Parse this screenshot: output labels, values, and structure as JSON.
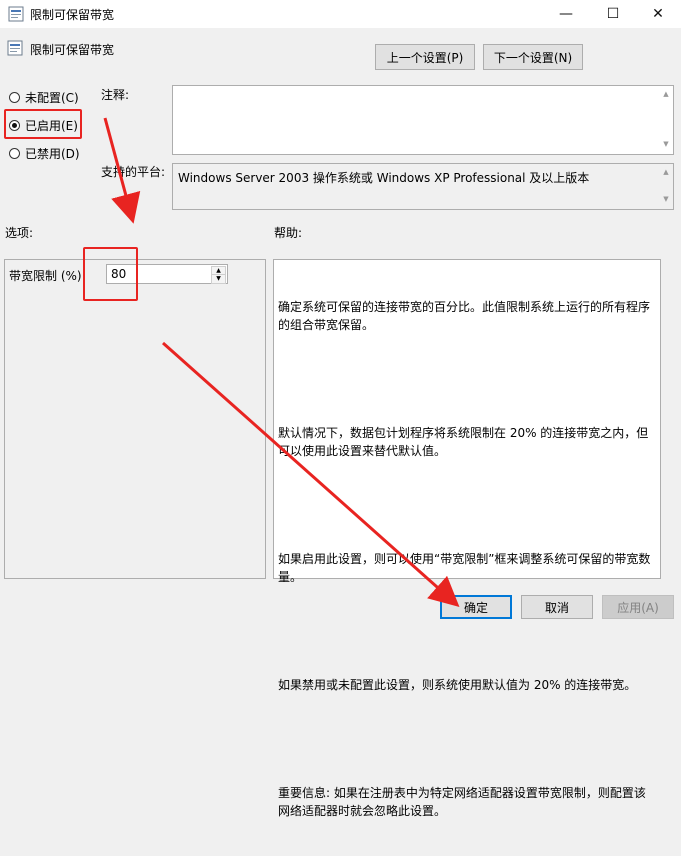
{
  "window": {
    "title": "限制可保留带宽",
    "minimize_glyph": "—",
    "maximize_glyph": "☐",
    "close_glyph": "✕"
  },
  "header": {
    "policy_name": "限制可保留带宽",
    "prev_button": "上一个设置(P)",
    "next_button": "下一个设置(N)"
  },
  "state": {
    "not_configured": "未配置(C)",
    "enabled": "已启用(E)",
    "disabled": "已禁用(D)",
    "selected": "enabled"
  },
  "comment": {
    "label": "注释:",
    "value": ""
  },
  "platform": {
    "label": "支持的平台:",
    "value": "Windows Server 2003 操作系统或 Windows XP Professional 及以上版本"
  },
  "options": {
    "label": "选项:",
    "bandwidth_label": "带宽限制 (%):",
    "bandwidth_value": "80"
  },
  "help": {
    "label": "帮助:",
    "paragraphs": [
      "确定系统可保留的连接带宽的百分比。此值限制系统上运行的所有程序的组合带宽保留。",
      "默认情况下，数据包计划程序将系统限制在 20% 的连接带宽之内，但可以使用此设置来替代默认值。",
      "如果启用此设置，则可以使用“带宽限制”框来调整系统可保留的带宽数量。",
      "如果禁用或未配置此设置，则系统使用默认值为 20% 的连接带宽。",
      "重要信息: 如果在注册表中为特定网络适配器设置带宽限制，则配置该网络适配器时就会忽略此设置。"
    ]
  },
  "footer": {
    "ok": "确定",
    "cancel": "取消",
    "apply": "应用(A)"
  },
  "colors": {
    "annotation_red": "#e82421",
    "focus_blue": "#0078d7"
  }
}
